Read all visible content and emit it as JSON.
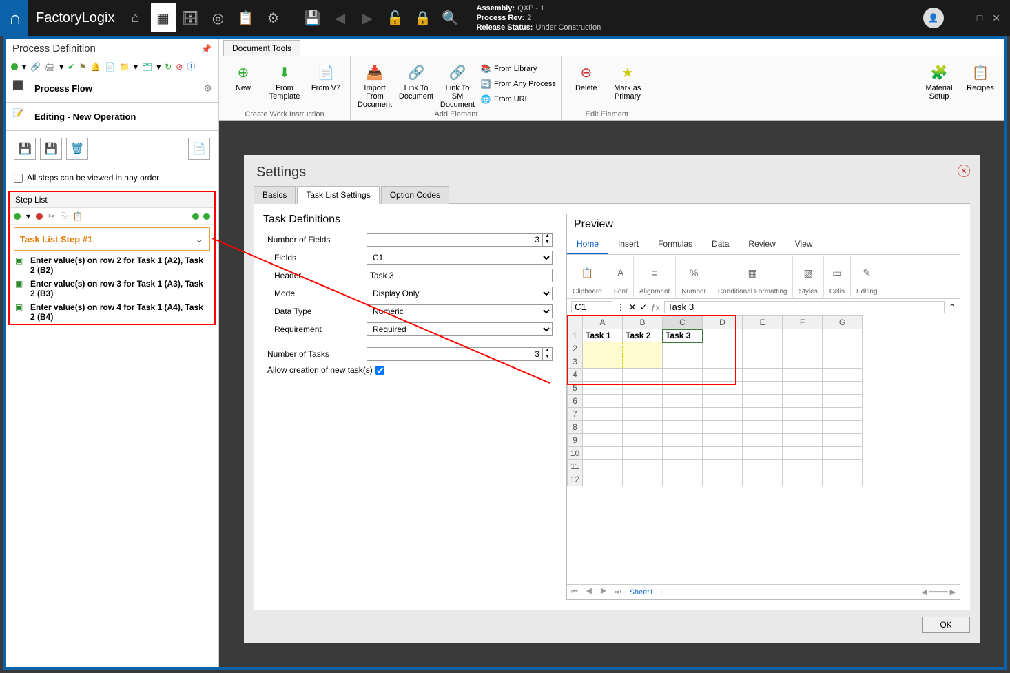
{
  "app": {
    "name": "FactoryLogix"
  },
  "assembly_info": {
    "assembly_label": "Assembly:",
    "assembly_value": "QXP - 1",
    "rev_label": "Process Rev:",
    "rev_value": "2",
    "status_label": "Release Status:",
    "status_value": "Under Construction"
  },
  "left_panel": {
    "title": "Process Definition",
    "process_flow": "Process Flow",
    "editing": "Editing - New Operation",
    "steps_any_order": "All steps can be viewed in any order",
    "step_list": "Step List",
    "selected_step": "Task List Step #1",
    "steps": [
      "Enter value(s) on row 2 for Task 1 (A2), Task 2 (B2)",
      "Enter value(s) on row 3 for Task 1 (A3), Task 2 (B3)",
      "Enter value(s) on row 4 for Task 1 (A4), Task 2 (B4)"
    ]
  },
  "ribbon": {
    "tab": "Document Tools",
    "groups": {
      "create": {
        "label": "Create Work Instruction",
        "items": [
          "New",
          "From Template",
          "From V7"
        ]
      },
      "add": {
        "label": "Add Element",
        "items": [
          "Import From Document",
          "Link To Document",
          "Link To SM Document"
        ],
        "small": [
          "From Library",
          "From Any Process",
          "From URL"
        ]
      },
      "edit": {
        "label": "Edit Element",
        "items": [
          "Delete",
          "Mark as Primary"
        ]
      }
    },
    "right": [
      "Material Setup",
      "Recipes"
    ]
  },
  "settings": {
    "title": "Settings",
    "tabs": [
      "Basics",
      "Task List Settings",
      "Option Codes"
    ],
    "active_tab": "Task List Settings",
    "task_defs_title": "Task Definitions",
    "fields": {
      "num_fields_label": "Number of Fields",
      "num_fields_value": "3",
      "fields_label": "Fields",
      "fields_value": "C1",
      "header_label": "Header",
      "header_value": "Task 3",
      "mode_label": "Mode",
      "mode_value": "Display Only",
      "datatype_label": "Data Type",
      "datatype_value": "Numeric",
      "requirement_label": "Requirement",
      "requirement_value": "Required",
      "num_tasks_label": "Number of Tasks",
      "num_tasks_value": "3",
      "allow_new_label": "Allow creation of new task(s)"
    },
    "preview_title": "Preview",
    "excel_tabs": [
      "Home",
      "Insert",
      "Formulas",
      "Data",
      "Review",
      "View"
    ],
    "excel_groups": [
      "Clipboard",
      "Font",
      "Alignment",
      "Number",
      "Conditional Formatting",
      "Styles",
      "Cells",
      "Editing"
    ],
    "cell_ref": "C1",
    "cell_value": "Task 3",
    "columns": [
      "A",
      "B",
      "C",
      "D",
      "E",
      "F",
      "G"
    ],
    "task_headers": [
      "Task 1",
      "Task 2",
      "Task 3"
    ],
    "sheet": "Sheet1",
    "ok": "OK"
  }
}
